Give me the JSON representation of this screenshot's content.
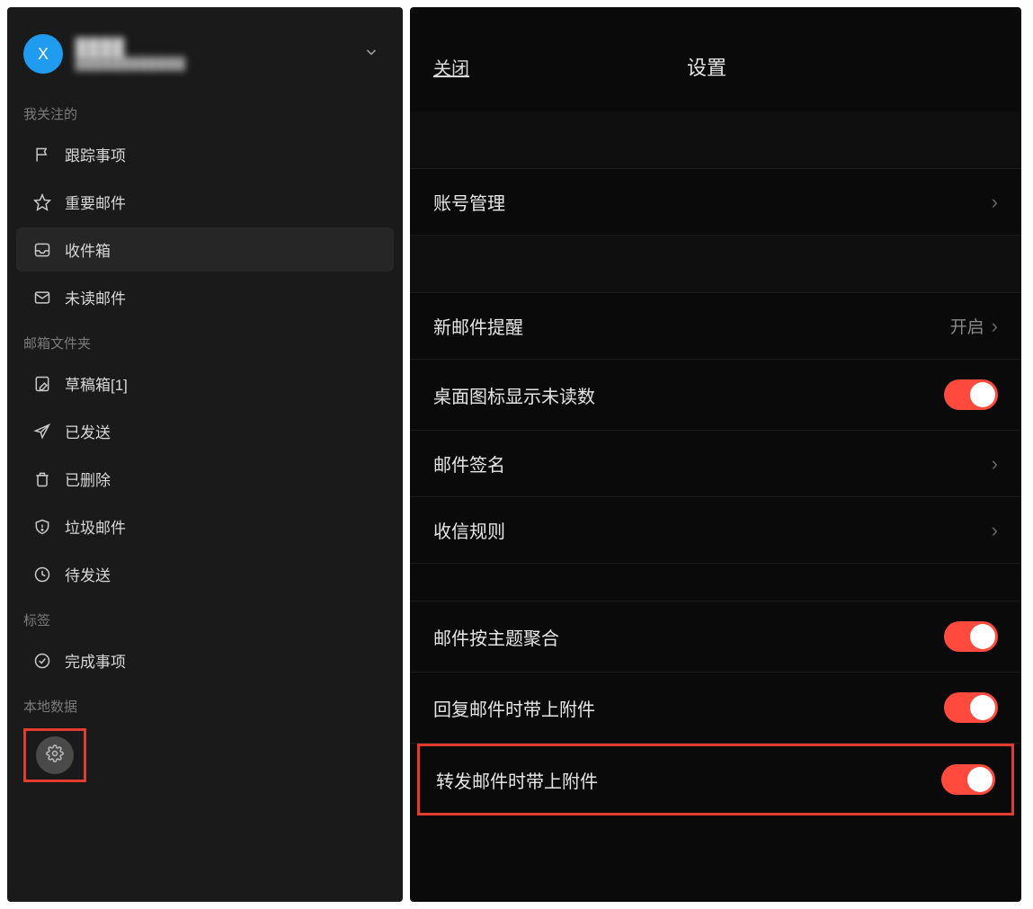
{
  "sidebar": {
    "avatar_letter": "X",
    "sections": {
      "follow": "我关注的",
      "folders": "邮箱文件夹",
      "tags": "标签",
      "local": "本地数据"
    },
    "items": {
      "track": "跟踪事项",
      "important": "重要邮件",
      "inbox": "收件箱",
      "unread": "未读邮件",
      "drafts": "草稿箱[1]",
      "sent": "已发送",
      "deleted": "已删除",
      "spam": "垃圾邮件",
      "outbox": "待发送",
      "done": "完成事项"
    }
  },
  "settings": {
    "close": "关闭",
    "title": "设置",
    "rows": {
      "account_mgmt": "账号管理",
      "new_mail_alert": {
        "label": "新邮件提醒",
        "value": "开启"
      },
      "badge_unread": "桌面图标显示未读数",
      "signature": "邮件签名",
      "receive_rules": "收信规则",
      "group_by_subject": "邮件按主题聚合",
      "reply_with_attach": "回复邮件时带上附件",
      "forward_with_attach": "转发邮件时带上附件"
    },
    "toggles": {
      "badge_unread": true,
      "group_by_subject": true,
      "reply_with_attach": true,
      "forward_with_attach": true
    }
  }
}
